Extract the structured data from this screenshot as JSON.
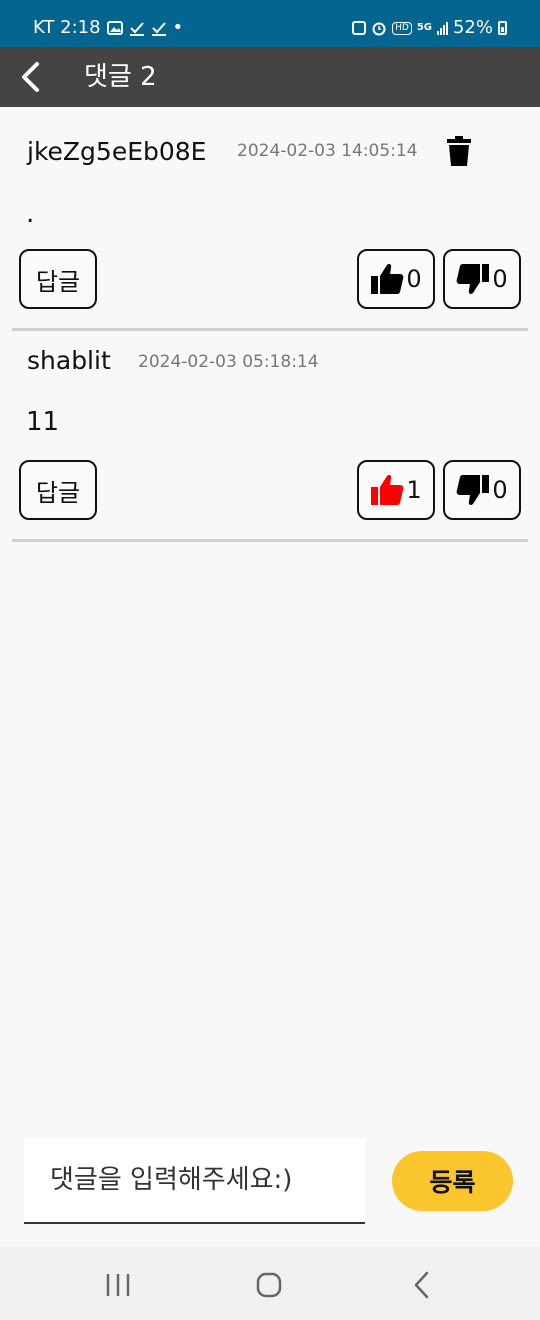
{
  "status_bar": {
    "carrier_time": "KT 2:18",
    "dot": "•",
    "hd": "HD",
    "network": "5G",
    "battery": "52%"
  },
  "app_bar": {
    "title": "댓글 2"
  },
  "comments": [
    {
      "author": "jkeZg5eEb08E",
      "date": "2024-02-03 14:05:14",
      "body": ".",
      "reply_label": "답글",
      "likes": "0",
      "dislikes": "0",
      "liked": false,
      "deletable": true
    },
    {
      "author": "shablit",
      "date": "2024-02-03 05:18:14",
      "body": "11",
      "reply_label": "답글",
      "likes": "1",
      "dislikes": "0",
      "liked": true,
      "deletable": false
    }
  ],
  "composer": {
    "placeholder": "댓글을 입력해주세요:)",
    "submit_label": "등록"
  },
  "colors": {
    "status_bar": "#046590",
    "app_bar": "#444444",
    "liked": "#ff0000",
    "submit": "#fbc52d"
  },
  "icons": {
    "back": "chevron-left-icon",
    "delete": "trash-icon",
    "like": "thumbs-up-icon",
    "dislike": "thumbs-down-icon"
  }
}
